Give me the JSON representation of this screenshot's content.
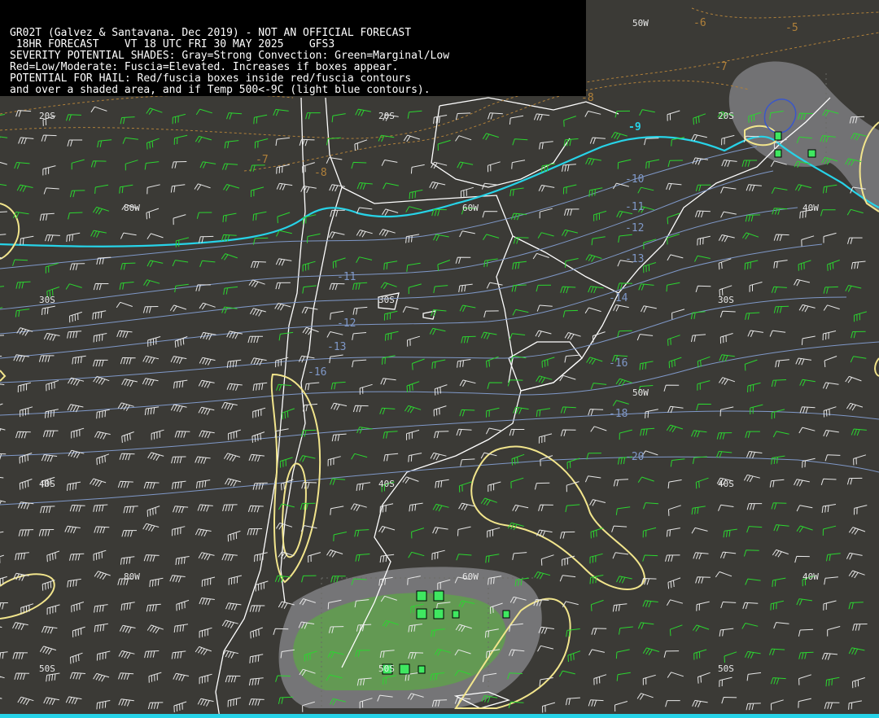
{
  "header": {
    "lines": [
      "GR02T (Galvez & Santavana. Dec 2019) - NOT AN OFFICIAL FORECAST",
      " 18HR FORECAST    VT 18 UTC FRI 30 MAY 2025    GFS3",
      "SEVERITY POTENTIAL SHADES: Gray=Strong Convection: Green=Marginal/Low",
      "Red=Low/Moderate: Fuscia=Elevated. Increases if boxes appear.",
      "POTENTIAL FOR HAIL: Red/fuscia boxes inside red/fuscia contours",
      "and over a shaded area, and if Temp 500<-9C (light blue contours)."
    ]
  },
  "grid_labels": {
    "lon": [
      "80W",
      "60W",
      "50W",
      "40W",
      "60W",
      "80W",
      "50W",
      "40W"
    ],
    "lat": [
      "20S",
      "20S",
      "20S",
      "30S",
      "30S",
      "30S",
      "40S",
      "40S",
      "40S",
      "50S",
      "50S",
      "50S"
    ]
  },
  "temp_labels": [
    "-9",
    "-10",
    "-11",
    "-12",
    "-13",
    "-14",
    "-16",
    "-18",
    "-20",
    "-11",
    "-12",
    "-13",
    "-16",
    "-5",
    "-6",
    "-7",
    "-7",
    "-8",
    "-8"
  ],
  "colors": {
    "background": "#3b3a36",
    "header_bg": "#000000",
    "header_text": "#ffffff",
    "coastline": "#ffffff",
    "temp_isotherm": "#7f98c8",
    "temp_minus9": "#27d3e8",
    "warm_isotherm": "#b0803a",
    "severity_contour": "#f2e58c",
    "wind_barb_green": "#2bd630",
    "wind_barb_white": "#e8e8e8",
    "shade_gray": "#8a8a8e",
    "shade_green": "#5fa24a",
    "hail_box": "#3fe860",
    "bottom_strip": "#27d3e8"
  }
}
